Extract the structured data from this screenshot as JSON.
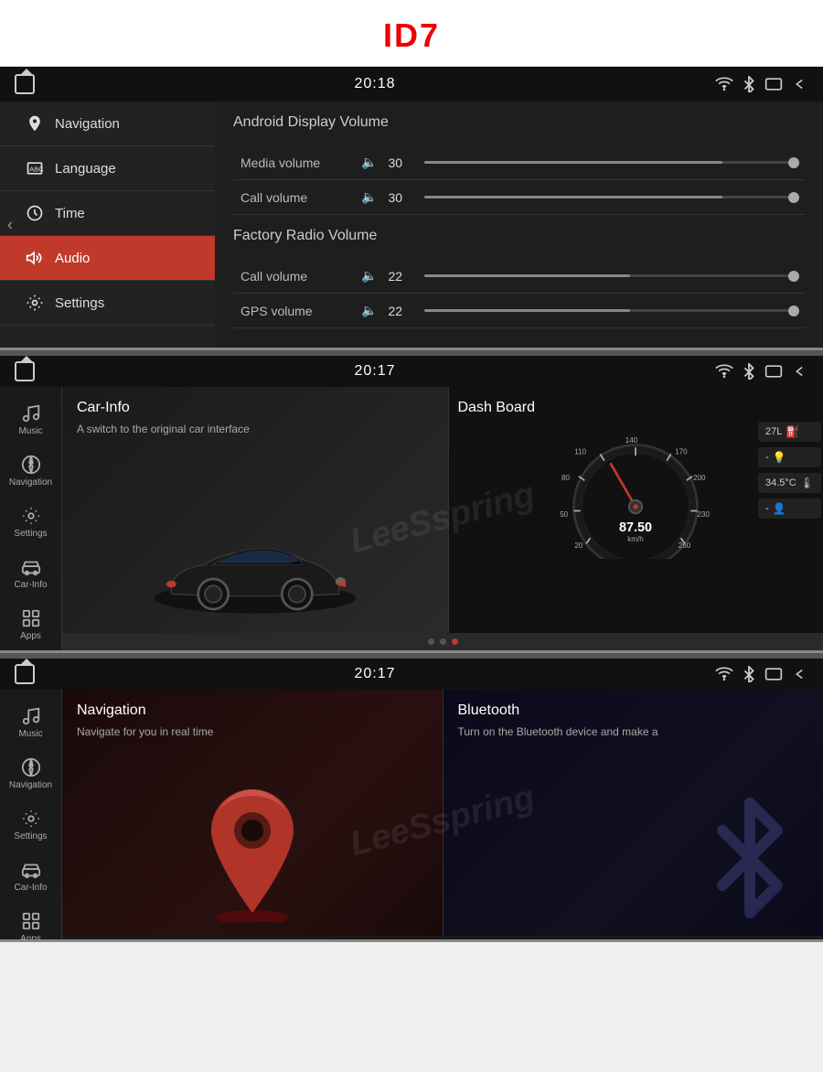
{
  "app": {
    "title": "ID7"
  },
  "screens": [
    {
      "id": "screen1",
      "status_bar": {
        "time": "20:18"
      },
      "sidebar": {
        "items": [
          {
            "id": "navigation",
            "label": "Navigation",
            "icon": "location-pin"
          },
          {
            "id": "language",
            "label": "Language",
            "icon": "text-abc"
          },
          {
            "id": "time",
            "label": "Time",
            "icon": "clock"
          },
          {
            "id": "audio",
            "label": "Audio",
            "icon": "speaker",
            "active": true
          },
          {
            "id": "settings",
            "label": "Settings",
            "icon": "gear"
          }
        ]
      },
      "main": {
        "android_section": "Android Display Volume",
        "factory_section": "Factory Radio Volume",
        "rows": [
          {
            "label": "Media volume",
            "value": "30",
            "fill_pct": 80
          },
          {
            "label": "Call volume",
            "value": "30",
            "fill_pct": 80
          },
          {
            "label": "Call volume",
            "value": "22",
            "fill_pct": 55
          },
          {
            "label": "GPS volume",
            "value": "22",
            "fill_pct": 55
          }
        ]
      }
    },
    {
      "id": "screen2",
      "status_bar": {
        "time": "20:17"
      },
      "left_nav": [
        {
          "id": "music",
          "label": "Music",
          "icon": "music-note"
        },
        {
          "id": "navigation",
          "label": "Navigation",
          "icon": "compass"
        },
        {
          "id": "settings",
          "label": "Settings",
          "icon": "gear"
        },
        {
          "id": "carinfo",
          "label": "Car-Info",
          "icon": "car"
        },
        {
          "id": "apps",
          "label": "Apps",
          "icon": "grid"
        }
      ],
      "cards": [
        {
          "title": "Car-Info",
          "description": "A switch to the original car interface"
        },
        {
          "title": "Dash Board",
          "speed": "87.50",
          "speed_unit": "km/h",
          "side_items": [
            {
              "label": "27L",
              "icon": "fuel"
            },
            {
              "label": "-",
              "icon": "lamp"
            },
            {
              "label": "34.5°C",
              "icon": "temp"
            },
            {
              "label": "-",
              "icon": "person"
            }
          ]
        }
      ],
      "dots": [
        false,
        false,
        true
      ]
    },
    {
      "id": "screen3",
      "status_bar": {
        "time": "20:17"
      },
      "left_nav": [
        {
          "id": "music",
          "label": "Music",
          "icon": "music-note"
        },
        {
          "id": "navigation",
          "label": "Navigation",
          "icon": "compass"
        },
        {
          "id": "settings",
          "label": "Settings",
          "icon": "gear"
        },
        {
          "id": "carinfo",
          "label": "Car-Info",
          "icon": "car"
        },
        {
          "id": "apps",
          "label": "Apps",
          "icon": "grid"
        }
      ],
      "cards": [
        {
          "title": "Navigation",
          "description": "Navigate for you in real time"
        },
        {
          "title": "Bluetooth",
          "description": "Turn on the Bluetooth device and make a"
        }
      ],
      "dots": [
        false,
        true,
        false
      ]
    }
  ],
  "watermark": "LeeSspring"
}
